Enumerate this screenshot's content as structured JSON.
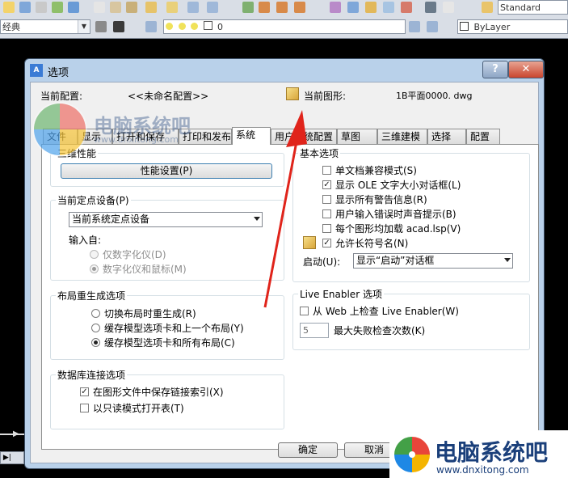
{
  "toolbar": {
    "combo_left": "经典",
    "layer_value": "0",
    "text_style": "Standard",
    "linetype": "ByLayer"
  },
  "dialog": {
    "title": "选项",
    "app_icon": "A",
    "help_label": "?",
    "close_label": "✕",
    "current_profile_label": "当前配置:",
    "current_profile_value": "<<未命名配置>>",
    "current_drawing_label": "当前图形:",
    "current_drawing_value": "1B平面0000. dwg",
    "ok_label": "确定",
    "cancel_label": "取消"
  },
  "tabs": [
    {
      "label": "文件"
    },
    {
      "label": "显示"
    },
    {
      "label": "打开和保存"
    },
    {
      "label": "打印和发布"
    },
    {
      "label": "系统"
    },
    {
      "label": "用户系统配置"
    },
    {
      "label": "草图"
    },
    {
      "label": "三维建模"
    },
    {
      "label": "选择"
    },
    {
      "label": "配置"
    }
  ],
  "performance": {
    "title": "三维性能",
    "button": "性能设置(P)"
  },
  "pointing": {
    "title": "当前定点设备(P)",
    "device": "当前系统定点设备",
    "input_from": "输入自:",
    "opt_digitizer": "仅数字化仪(D)",
    "opt_digitizer_mouse": "数字化仪和鼠标(M)"
  },
  "layout_regen": {
    "title": "布局重生成选项",
    "opt1": "切换布局时重生成(R)",
    "opt2": "缓存模型选项卡和上一个布局(Y)",
    "opt3": "缓存模型选项卡和所有布局(C)"
  },
  "db_connect": {
    "title": "数据库连接选项",
    "opt1": "在图形文件中保存链接索引(X)",
    "opt2": "以只读模式打开表(T)"
  },
  "general": {
    "title": "基本选项",
    "opt1": "单文档兼容模式(S)",
    "opt2": "显示 OLE 文字大小对话框(L)",
    "opt3": "显示所有警告信息(R)",
    "opt4": "用户输入错误时声音提示(B)",
    "opt5": "每个图形均加载 acad.lsp(V)",
    "opt6": "允许长符号名(N)",
    "startup_label": "启动(U):",
    "startup_value": "显示“启动”对话框"
  },
  "live_enabler": {
    "title": "Live Enabler 选项",
    "check_web": "从 Web 上检查 Live Enabler(W)",
    "max_fail_value": "5",
    "max_fail_label": "最大失败检查次数(K)"
  },
  "watermark": {
    "site_text": "电脑系统吧",
    "url": "www.dnxitong.com"
  },
  "colors": {
    "arrow": "#e0241b",
    "dialog_frame": "#b9d1ea"
  }
}
